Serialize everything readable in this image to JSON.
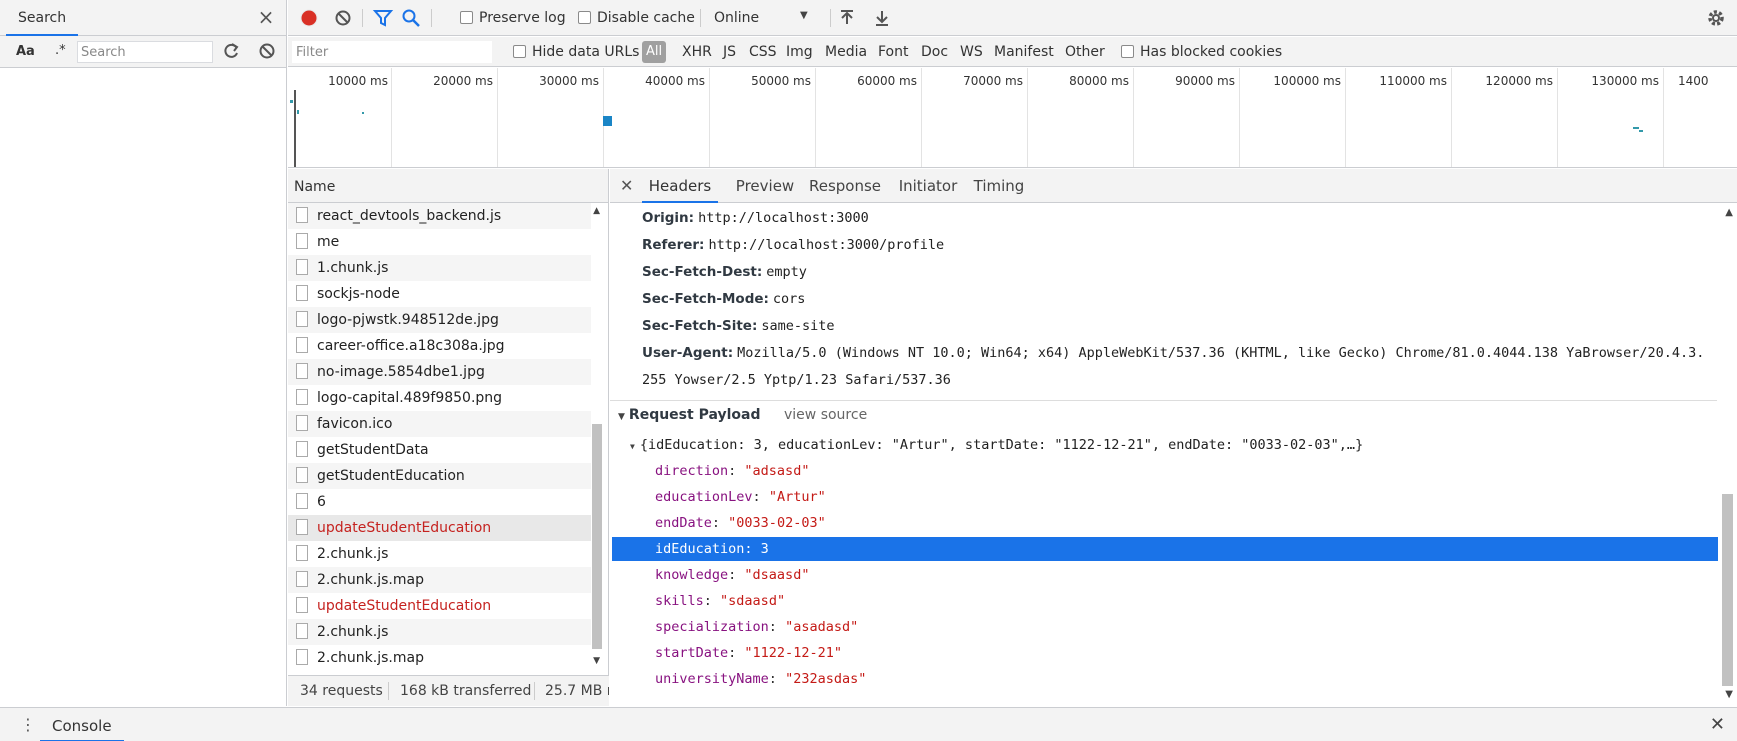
{
  "search_panel": {
    "tab_label": "Search",
    "case_label": "Aa",
    "regex_label": ".*",
    "input_placeholder": "Search"
  },
  "toolbar": {
    "preserve_log": "Preserve log",
    "disable_cache": "Disable cache",
    "throttling": "Online"
  },
  "filterbar": {
    "filter_placeholder": "Filter",
    "hide_data_urls": "Hide data URLs",
    "types": [
      "All",
      "XHR",
      "JS",
      "CSS",
      "Img",
      "Media",
      "Font",
      "Doc",
      "WS",
      "Manifest",
      "Other"
    ],
    "has_blocked_cookies": "Has blocked cookies"
  },
  "overview": {
    "ticks": [
      "10000 ms",
      "20000 ms",
      "30000 ms",
      "40000 ms",
      "50000 ms",
      "60000 ms",
      "70000 ms",
      "80000 ms",
      "90000 ms",
      "100000 ms",
      "110000 ms",
      "120000 ms",
      "130000 ms",
      "1400"
    ]
  },
  "requests": {
    "header": "Name",
    "items": [
      {
        "name": "react_devtools_backend.js",
        "error": false
      },
      {
        "name": "me",
        "error": false
      },
      {
        "name": "1.chunk.js",
        "error": false
      },
      {
        "name": "sockjs-node",
        "error": false
      },
      {
        "name": "logo-pjwstk.948512de.jpg",
        "error": false
      },
      {
        "name": "career-office.a18c308a.jpg",
        "error": false
      },
      {
        "name": "no-image.5854dbe1.jpg",
        "error": false
      },
      {
        "name": "logo-capital.489f9850.png",
        "error": false
      },
      {
        "name": "favicon.ico",
        "error": false
      },
      {
        "name": "getStudentData",
        "error": false
      },
      {
        "name": "getStudentEducation",
        "error": false
      },
      {
        "name": "6",
        "error": false
      },
      {
        "name": "updateStudentEducation",
        "error": true
      },
      {
        "name": "2.chunk.js",
        "error": false
      },
      {
        "name": "2.chunk.js.map",
        "error": false
      },
      {
        "name": "updateStudentEducation",
        "error": true
      },
      {
        "name": "2.chunk.js",
        "error": false
      },
      {
        "name": "2.chunk.js.map",
        "error": false
      }
    ]
  },
  "status": {
    "requests": "34 requests",
    "transferred": "168 kB transferred",
    "resources": "25.7 MB r"
  },
  "detail": {
    "tabs": [
      "Headers",
      "Preview",
      "Response",
      "Initiator",
      "Timing"
    ],
    "headers": [
      {
        "name": "Origin:",
        "value": "http://localhost:3000"
      },
      {
        "name": "Referer:",
        "value": "http://localhost:3000/profile"
      },
      {
        "name": "Sec-Fetch-Dest:",
        "value": "empty"
      },
      {
        "name": "Sec-Fetch-Mode:",
        "value": "cors"
      },
      {
        "name": "Sec-Fetch-Site:",
        "value": "same-site"
      },
      {
        "name": "User-Agent:",
        "value": "Mozilla/5.0 (Windows NT 10.0; Win64; x64) AppleWebKit/537.36 (KHTML, like Gecko) Chrome/81.0.4044.138 YaBrowser/20.4.3."
      },
      {
        "name": "",
        "value": "255 Yowser/2.5 Yptp/1.23 Safari/537.36"
      }
    ],
    "payload_title": "Request Payload",
    "view_source": "view source",
    "payload_summary": "{idEducation: 3, educationLev: \"Artur\", startDate: \"1122-12-21\", endDate: \"0033-02-03\",…}",
    "payload": [
      {
        "key": "direction",
        "value": "\"adsasd\"",
        "type": "str"
      },
      {
        "key": "educationLev",
        "value": "\"Artur\"",
        "type": "str"
      },
      {
        "key": "endDate",
        "value": "\"0033-02-03\"",
        "type": "str"
      },
      {
        "key": "idEducation",
        "value": "3",
        "type": "num"
      },
      {
        "key": "knowledge",
        "value": "\"dsaasd\"",
        "type": "str"
      },
      {
        "key": "skills",
        "value": "\"sdaasd\"",
        "type": "str"
      },
      {
        "key": "specialization",
        "value": "\"asadasd\"",
        "type": "str"
      },
      {
        "key": "startDate",
        "value": "\"1122-12-21\"",
        "type": "str"
      },
      {
        "key": "universityName",
        "value": "\"232asdas\"",
        "type": "str"
      }
    ]
  },
  "drawer": {
    "console_label": "Console"
  },
  "colors": {
    "accent": "#1a73e8",
    "record": "#d93025",
    "error_text": "#c5221f"
  }
}
